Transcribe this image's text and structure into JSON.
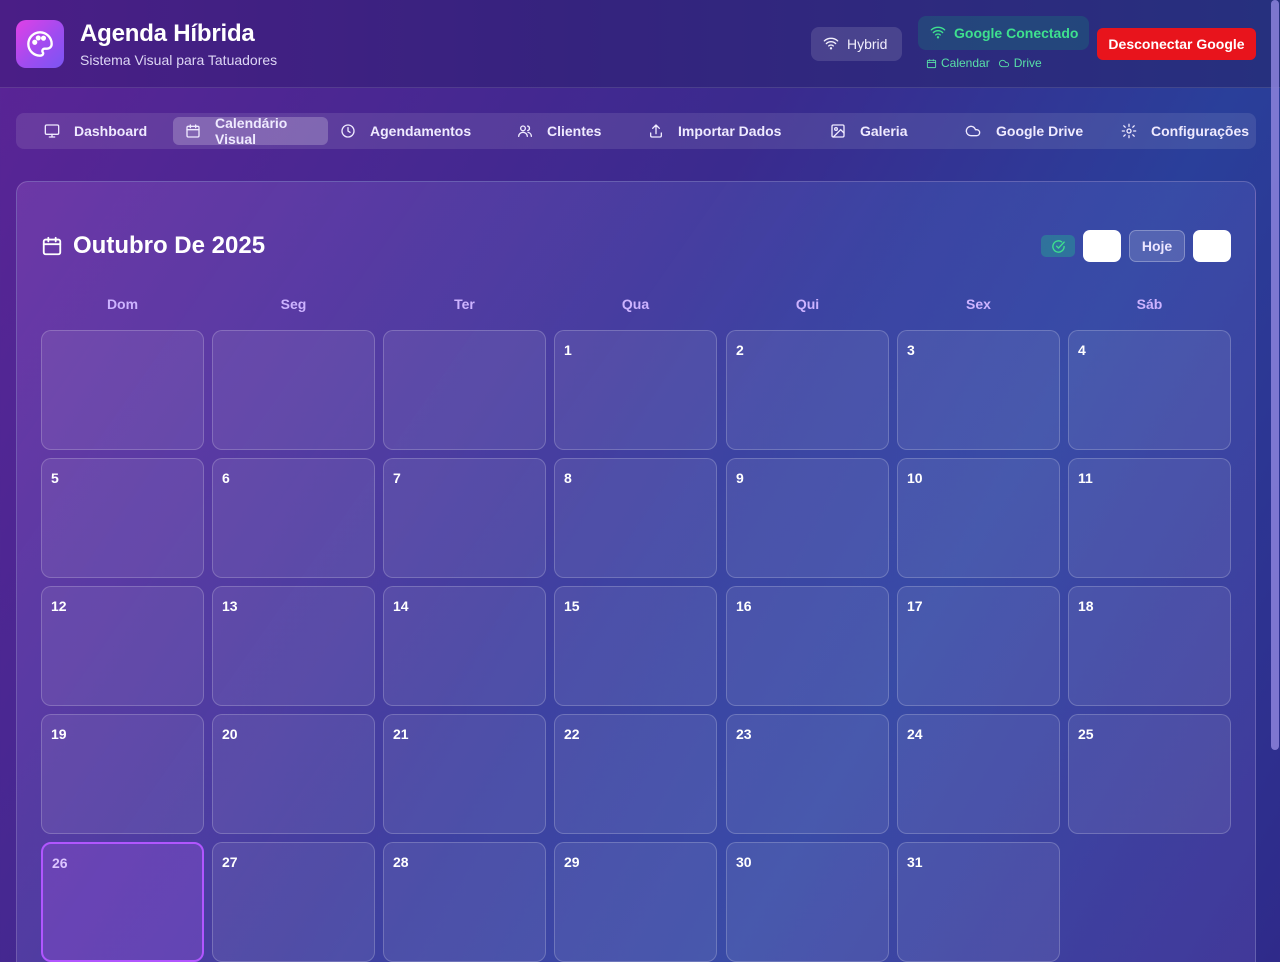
{
  "app": {
    "title": "Agenda Híbrida",
    "subtitle": "Sistema Visual para Tatuadores"
  },
  "header": {
    "mode_label": "Hybrid",
    "google_status": "Google Conectado",
    "services": [
      "Calendar",
      "Drive"
    ],
    "disconnect_label": "Desconectar Google"
  },
  "nav": {
    "items": [
      {
        "label": "Dashboard",
        "icon": "monitor-icon",
        "active": false
      },
      {
        "label": "Calendário Visual",
        "icon": "calendar-icon",
        "active": true
      },
      {
        "label": "Agendamentos",
        "icon": "clock-icon",
        "active": false
      },
      {
        "label": "Clientes",
        "icon": "users-icon",
        "active": false
      },
      {
        "label": "Importar Dados",
        "icon": "upload-icon",
        "active": false
      },
      {
        "label": "Galeria",
        "icon": "image-icon",
        "active": false
      },
      {
        "label": "Google Drive",
        "icon": "cloud-icon",
        "active": false
      },
      {
        "label": "Configurações",
        "icon": "gear-icon",
        "active": false
      }
    ]
  },
  "calendar": {
    "month_title": "Outubro De 2025",
    "today_label": "Hoje",
    "weekdays": [
      "Dom",
      "Seg",
      "Ter",
      "Qua",
      "Qui",
      "Sex",
      "Sáb"
    ],
    "first_weekday_index": 3,
    "days_in_month": 31,
    "today": 26,
    "days": [
      "1",
      "2",
      "3",
      "4",
      "5",
      "6",
      "7",
      "8",
      "9",
      "10",
      "11",
      "12",
      "13",
      "14",
      "15",
      "16",
      "17",
      "18",
      "19",
      "20",
      "21",
      "22",
      "23",
      "24",
      "25",
      "26",
      "27",
      "28",
      "29",
      "30",
      "31"
    ]
  },
  "colors": {
    "accent_purple": "#b156ff",
    "disconnect_red": "#e8141c",
    "connected_green": "#3ee08e"
  }
}
